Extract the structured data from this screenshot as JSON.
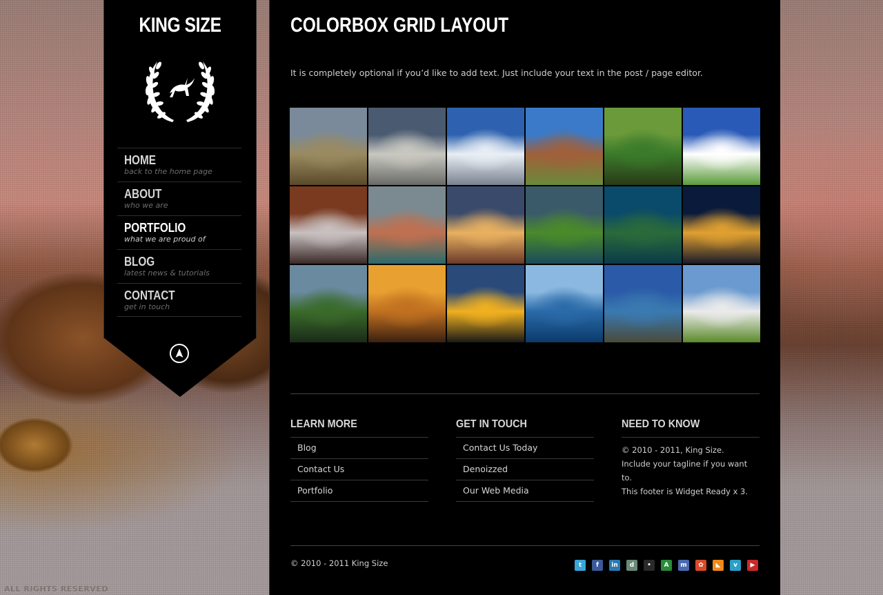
{
  "site": {
    "title": "KING SIZE",
    "rights": "ALL RIGHTS RESERVED"
  },
  "nav": [
    {
      "label": "HOME",
      "sub": "back to the home page"
    },
    {
      "label": "ABOUT",
      "sub": "who we are"
    },
    {
      "label": "PORTFOLIO",
      "sub": "what we are proud of",
      "active": true
    },
    {
      "label": "BLOG",
      "sub": "latest news & tutorials"
    },
    {
      "label": "CONTACT",
      "sub": "get in touch"
    }
  ],
  "page": {
    "title": "COLORBOX GRID LAYOUT",
    "intro": "It is completely optional if you’d like to add text.  Just include your text in the post / page editor."
  },
  "gallery": [
    {
      "name": "rolling-hills",
      "colors": [
        "#7a8a9a",
        "#9a8a60",
        "#5a4a2a"
      ]
    },
    {
      "name": "storm-clouds",
      "colors": [
        "#4a5a70",
        "#c8c8c0",
        "#6a6a68"
      ]
    },
    {
      "name": "snowy-mountains",
      "colors": [
        "#2e62b0",
        "#e8eef4",
        "#7a8290"
      ]
    },
    {
      "name": "cliff-bridge",
      "colors": [
        "#3a7ac8",
        "#a0603a",
        "#6a8a3a"
      ]
    },
    {
      "name": "green-pond",
      "colors": [
        "#6a9a3a",
        "#3a7a2a",
        "#2a3a18"
      ]
    },
    {
      "name": "house-on-hill",
      "colors": [
        "#2a5ab8",
        "#ffffff",
        "#5a9a3a"
      ]
    },
    {
      "name": "frosted-tree",
      "colors": [
        "#7a3a20",
        "#c8c0c0",
        "#3a2a28"
      ]
    },
    {
      "name": "lakeside-village",
      "colors": [
        "#7a8a90",
        "#c07050",
        "#2a6a6a"
      ]
    },
    {
      "name": "red-barn",
      "colors": [
        "#3a4a6a",
        "#e8b060",
        "#6a3a2a"
      ]
    },
    {
      "name": "green-lights",
      "colors": [
        "#3a5a6a",
        "#4a8a2a",
        "#1a4a5a"
      ]
    },
    {
      "name": "forest-peninsula",
      "colors": [
        "#0a4a6a",
        "#2a6a3a",
        "#0a3a4a"
      ]
    },
    {
      "name": "night-castle",
      "colors": [
        "#0a1a3a",
        "#e0a030",
        "#1a1a2a"
      ]
    },
    {
      "name": "coastal-road",
      "colors": [
        "#6a8aa0",
        "#3a6a2a",
        "#1a2a18"
      ]
    },
    {
      "name": "orange-sunset-islets",
      "colors": [
        "#e8a030",
        "#c07020",
        "#3a2010"
      ]
    },
    {
      "name": "golden-seascape",
      "colors": [
        "#2a4a7a",
        "#f0b020",
        "#1a1a18"
      ]
    },
    {
      "name": "blue-bay",
      "colors": [
        "#8ab8e0",
        "#2a6aa8",
        "#0a3a6a"
      ]
    },
    {
      "name": "rocky-shore",
      "colors": [
        "#2a5aa8",
        "#3a7ab0",
        "#4a4a3a"
      ]
    },
    {
      "name": "alpine-valley",
      "colors": [
        "#6a9ad0",
        "#eaeaea",
        "#5a8a2a"
      ]
    }
  ],
  "footer": {
    "learn_more": {
      "title": "LEARN MORE",
      "links": [
        "Blog",
        "Contact Us",
        "Portfolio"
      ]
    },
    "get_in_touch": {
      "title": "GET IN TOUCH",
      "links": [
        "Contact Us Today",
        "Denoizzed",
        "Our Web Media"
      ]
    },
    "need_to_know": {
      "title": "NEED TO KNOW",
      "lines": [
        "© 2010 - 2011, King Size.",
        "Include your tagline if you want to.",
        "This footer is Widget Ready x 3."
      ]
    },
    "copyright": "© 2010 - 2011 King Size",
    "social": [
      {
        "name": "twitter",
        "color": "#3aa6d8",
        "glyph": "t"
      },
      {
        "name": "facebook",
        "color": "#3b5a9a",
        "glyph": "f"
      },
      {
        "name": "linkedin",
        "color": "#2a7ab0",
        "glyph": "in"
      },
      {
        "name": "delicious",
        "color": "#6a8a7a",
        "glyph": "d"
      },
      {
        "name": "flickr",
        "color": "#2a2a2a",
        "glyph": "•"
      },
      {
        "name": "deviantart",
        "color": "#2a8a3a",
        "glyph": "A"
      },
      {
        "name": "myspace",
        "color": "#4a6ab0",
        "glyph": "m"
      },
      {
        "name": "picasa",
        "color": "#d84a2a",
        "glyph": "✿"
      },
      {
        "name": "rss",
        "color": "#f08a1a",
        "glyph": "◣"
      },
      {
        "name": "vimeo",
        "color": "#2aa0c8",
        "glyph": "v"
      },
      {
        "name": "youtube",
        "color": "#c82a2a",
        "glyph": "▶"
      }
    ]
  }
}
